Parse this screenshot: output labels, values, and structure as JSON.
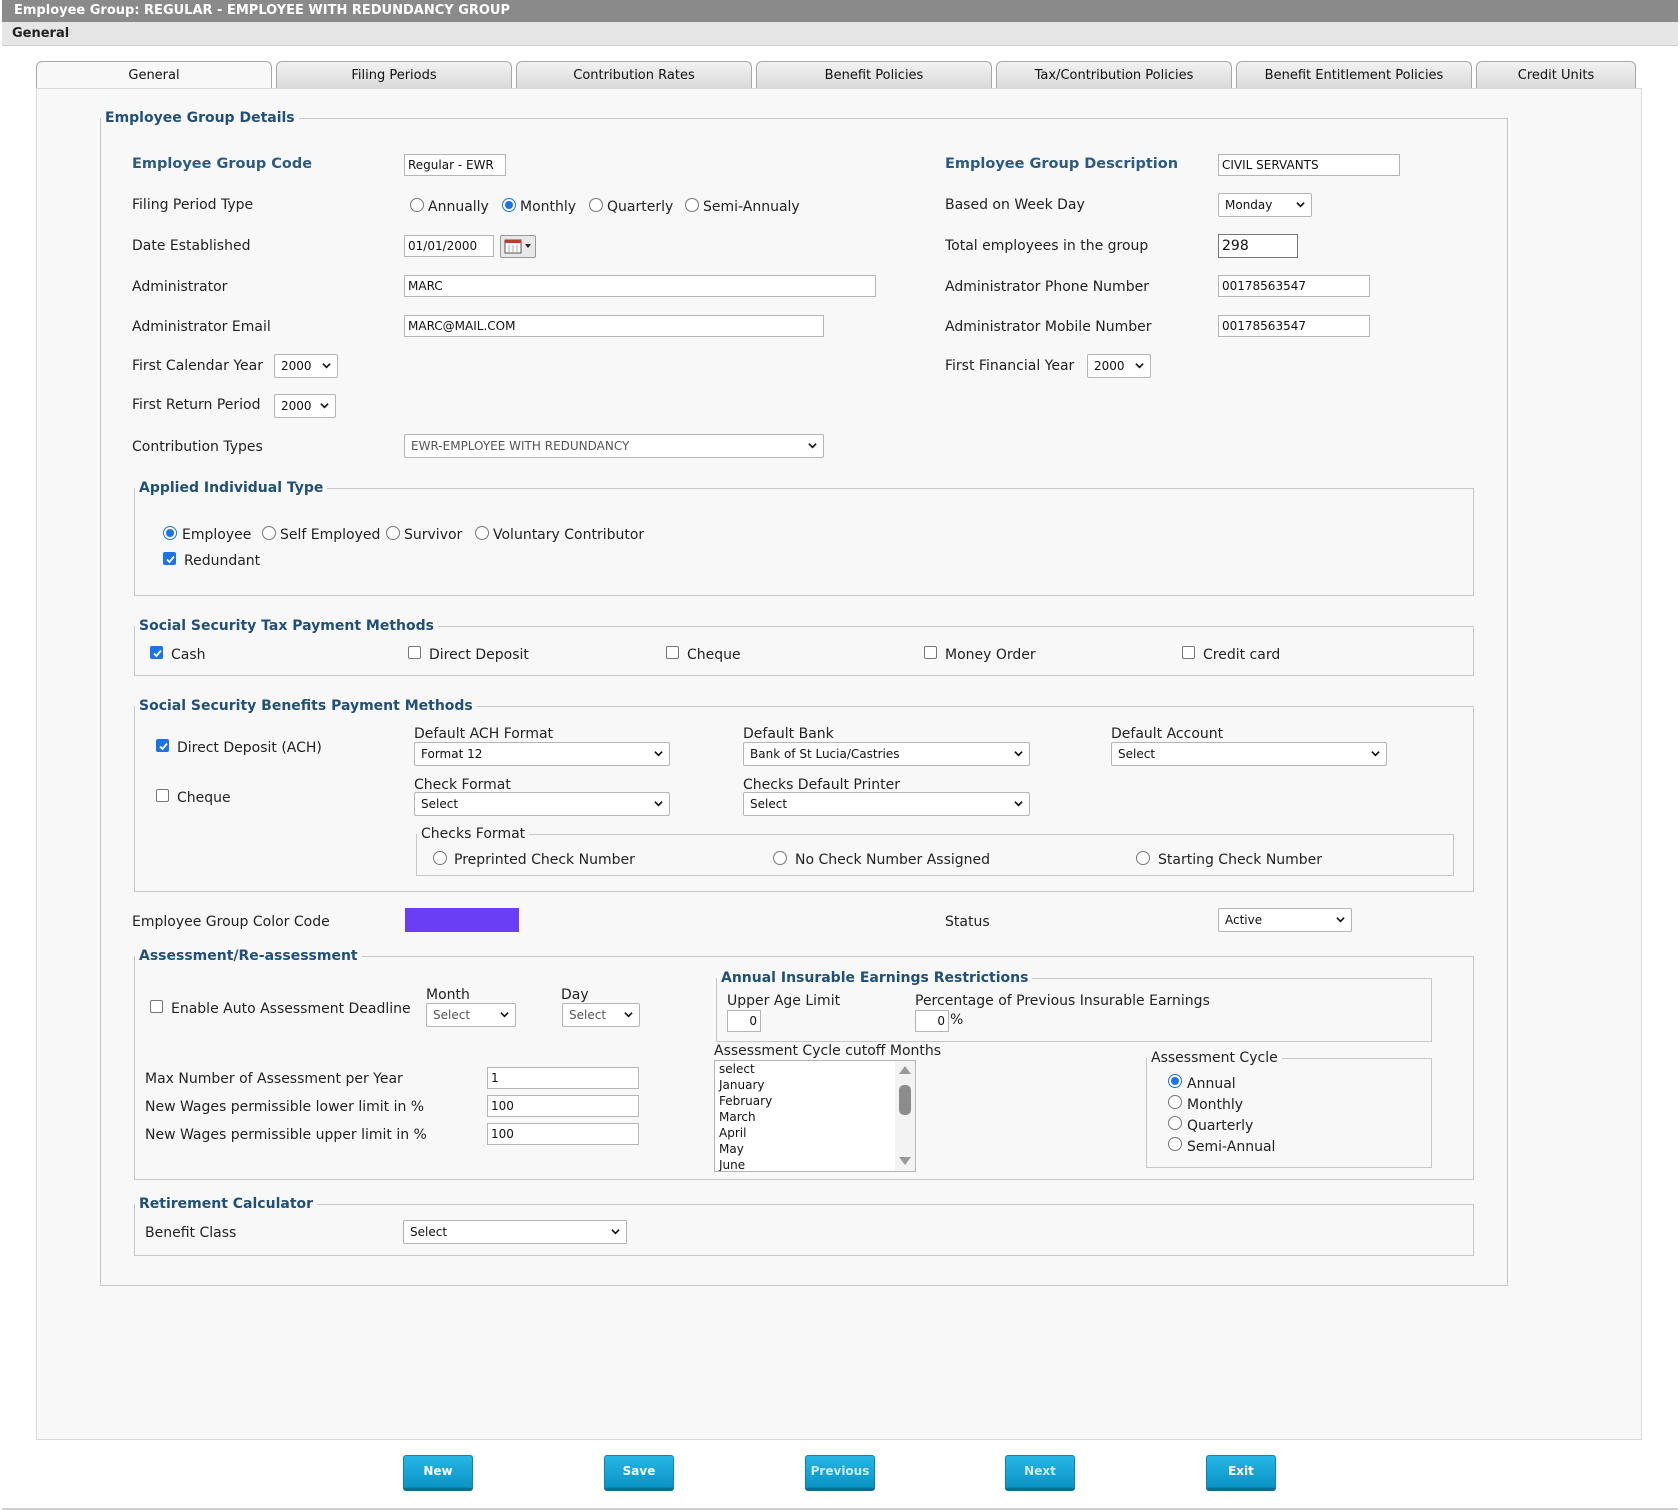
{
  "window": {
    "title": "Employee Group: REGULAR - EMPLOYEE WITH REDUNDANCY GROUP",
    "subtitle": "General"
  },
  "tabs": [
    "General",
    "Filing Periods",
    "Contribution Rates",
    "Benefit Policies",
    "Tax/Contribution Policies",
    "Benefit Entitlement Policies",
    "Credit Units"
  ],
  "details": {
    "legend": "Employee Group Details",
    "code_label": "Employee Group Code",
    "code_value": "Regular - EWR",
    "description_label": "Employee Group Description",
    "description_value": "CIVIL SERVANTS",
    "filing_label": "Filing Period Type",
    "filing_options": [
      "Annually",
      "Monthly",
      "Quarterly",
      "Semi-Annualy"
    ],
    "filing_selected": "Monthly",
    "weekday_label": "Based on Week Day",
    "weekday_value": "Monday",
    "date_label": "Date Established",
    "date_value": "01/01/2000",
    "total_label": "Total employees in the group",
    "total_value": "298",
    "admin_label": "Administrator",
    "admin_value": "MARC",
    "admin_phone_label": "Administrator Phone Number",
    "admin_phone_value": "00178563547",
    "admin_email_label": "Administrator Email",
    "admin_email_value": "MARC@MAIL.COM",
    "admin_mobile_label": "Administrator Mobile Number",
    "admin_mobile_value": "00178563547",
    "first_cal_label": "First Calendar Year",
    "first_cal_value": "2000",
    "first_fin_label": "First Financial Year",
    "first_fin_value": "2000",
    "first_return_label": "First Return Period",
    "first_return_value": "2000",
    "contrib_label": "Contribution Types",
    "contrib_value": "EWR-EMPLOYEE WITH REDUNDANCY"
  },
  "individual": {
    "legend": "Applied Individual Type",
    "options": [
      "Employee",
      "Self Employed",
      "Survivor",
      "Voluntary Contributor"
    ],
    "selected": "Employee",
    "redundant_label": "Redundant",
    "redundant_checked": true
  },
  "tax_methods": {
    "legend": "Social Security Tax Payment Methods",
    "items": [
      {
        "label": "Cash",
        "checked": true
      },
      {
        "label": "Direct Deposit",
        "checked": false
      },
      {
        "label": "Cheque",
        "checked": false
      },
      {
        "label": "Money Order",
        "checked": false
      },
      {
        "label": "Credit card",
        "checked": false
      }
    ]
  },
  "benefit_methods": {
    "legend": "Social Security Benefits Payment Methods",
    "dd_label": "Direct Deposit (ACH)",
    "dd_checked": true,
    "cheque_label": "Cheque",
    "cheque_checked": false,
    "ach_format_label": "Default ACH Format",
    "ach_format_value": "Format 12",
    "bank_label": "Default Bank",
    "bank_value": "Bank of St Lucia/Castries",
    "account_label": "Default Account",
    "account_value": "Select",
    "check_format_label": "Check Format",
    "check_format_value": "Select",
    "printer_label": "Checks Default Printer",
    "printer_value": "Select",
    "checks_format_legend": "Checks Format",
    "checks_format_options": [
      "Preprinted Check Number",
      "No Check Number Assigned",
      "Starting Check Number"
    ]
  },
  "color_code": {
    "label": "Employee Group Color Code",
    "color": "#6a3ef5"
  },
  "status": {
    "label": "Status",
    "value": "Active"
  },
  "assessment": {
    "legend": "Assessment/Re-assessment",
    "auto_label": "Enable Auto Assessment Deadline",
    "auto_checked": false,
    "month_label": "Month",
    "month_value": "Select",
    "day_label": "Day",
    "day_value": "Select",
    "max_label": "Max Number of Assessment per Year",
    "max_value": "1",
    "lower_label": "New Wages permissible lower limit in %",
    "lower_value": "100",
    "upper_label": "New Wages permissible upper limit in %",
    "upper_value": "100",
    "restrictions_legend": "Annual Insurable Earnings Restrictions",
    "upper_age_label": "Upper Age Limit",
    "upper_age_value": "0",
    "pct_label": "Percentage of Previous Insurable Earnings",
    "pct_value": "0",
    "pct_suffix": "%",
    "cutoff_label": "Assessment Cycle cutoff Months",
    "cutoff_options": [
      "select",
      "January",
      "February",
      "March",
      "April",
      "May",
      "June"
    ],
    "cycle_legend": "Assessment Cycle",
    "cycle_options": [
      "Annual",
      "Monthly",
      "Quarterly",
      "Semi-Annual"
    ],
    "cycle_selected": "Annual"
  },
  "retirement": {
    "legend": "Retirement Calculator",
    "benefit_class_label": "Benefit Class",
    "benefit_class_value": "Select"
  },
  "buttons": {
    "new": "New",
    "save": "Save",
    "previous": "Previous",
    "next": "Next",
    "exit": "Exit"
  },
  "colors": {
    "accent": "#1a73e8",
    "button": "#0b94c6",
    "legend": "#1f4f7a",
    "titlebar": "#8a8a8a"
  }
}
